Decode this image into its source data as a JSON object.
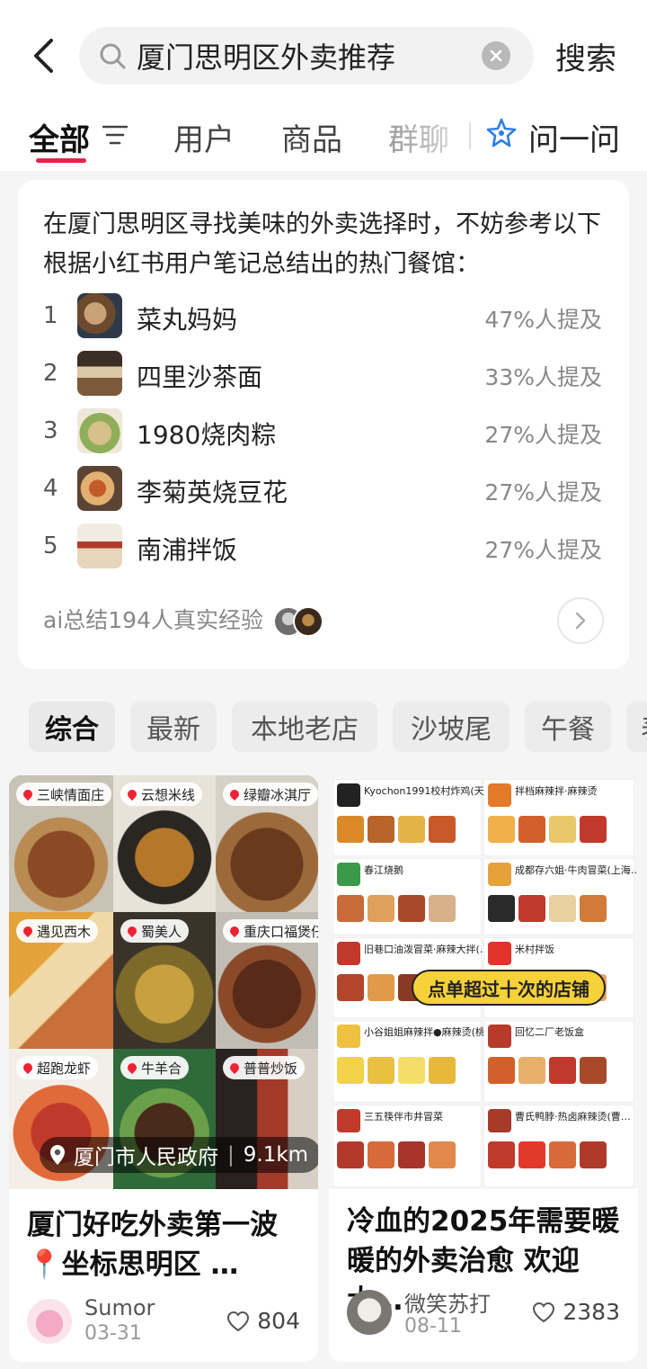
{
  "search": {
    "query": "厦门思明区外卖推荐",
    "button": "搜索"
  },
  "tabs": [
    {
      "label": "全部",
      "active": true
    },
    {
      "label": "用户"
    },
    {
      "label": "商品"
    },
    {
      "label": "群聊"
    },
    {
      "label": "问一问"
    }
  ],
  "ai_summary": {
    "intro": "在厦门思明区寻找美味的外卖选择时，不妨参考以下根据小红书用户笔记总结出的热门餐馆：",
    "items": [
      {
        "rank": "1",
        "name": "菜丸妈妈",
        "percent": "47%人提及"
      },
      {
        "rank": "2",
        "name": "四里沙茶面",
        "percent": "33%人提及"
      },
      {
        "rank": "3",
        "name": "1980烧肉粽",
        "percent": "27%人提及"
      },
      {
        "rank": "4",
        "name": "李菊英烧豆花",
        "percent": "27%人提及"
      },
      {
        "rank": "5",
        "name": "南浦拌饭",
        "percent": "27%人提及"
      }
    ],
    "footer": "ai总结194人真实经验"
  },
  "filters": [
    "综合",
    "最新",
    "本地老店",
    "沙坡尾",
    "午餐",
    "表"
  ],
  "feed": [
    {
      "title": "厦门好吃外卖第一波 📍坐标思明区 …",
      "location": "厦门市人民政府",
      "distance": "9.1km",
      "author": "Sumor",
      "date": "03-31",
      "likes": "804",
      "tags": [
        "三峡情面庄",
        "云想米线",
        "绿瓣冰淇厅",
        "遇见西木",
        "蜀美人",
        "重庆口福煲仔饭",
        "超跑龙虾",
        "牛羊合",
        "普普炒饭"
      ]
    },
    {
      "title": "冷血的2025年需要暖暖的外卖治愈 欢迎大…",
      "banner": "点单超过十次的店铺",
      "author": "微笑苏打",
      "date": "08-11",
      "likes": "2383",
      "shops": [
        "Kyochon1991校村炸鸡(天…",
        "拌档麻辣拌·麻辣烫",
        "春江烧鹅",
        "成都存六姐·牛肉冒菜(上海…",
        "旧巷口油泼冒菜·麻辣大拌(…",
        "米村拌饭",
        "小谷姐姐麻辣拌●麻辣烫(桃…",
        "回忆二厂老饭盒",
        "三五筷伴市井冒菜",
        "曹氏鸭脖·热卤麻辣烫(曹…"
      ]
    }
  ],
  "colors": {
    "accent": "#e5234a",
    "ask_icon": "#2f7fe6",
    "banner": "#f7d13a"
  }
}
